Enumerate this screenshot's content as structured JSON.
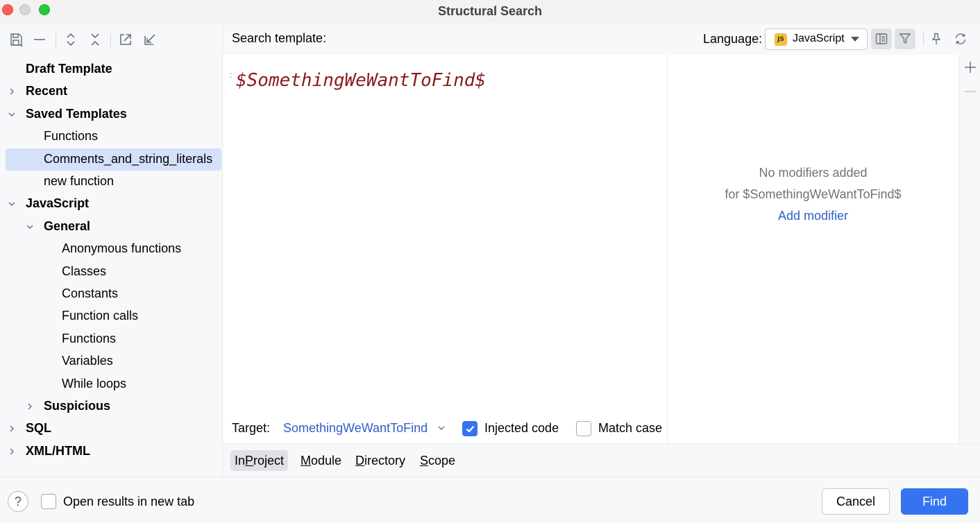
{
  "window": {
    "title": "Structural Search"
  },
  "tree": {
    "items": [
      {
        "label": "Draft Template",
        "bold": true,
        "level": 0,
        "expander": "none"
      },
      {
        "label": "Recent",
        "bold": true,
        "level": 0,
        "expander": "collapsed"
      },
      {
        "label": "Saved Templates",
        "bold": true,
        "level": 0,
        "expander": "expanded"
      },
      {
        "label": "Functions",
        "bold": false,
        "level": 1,
        "expander": "none"
      },
      {
        "label": "Comments_and_string_literals",
        "bold": false,
        "level": 1,
        "expander": "none",
        "selected": true
      },
      {
        "label": "new function",
        "bold": false,
        "level": 1,
        "expander": "none"
      },
      {
        "label": "JavaScript",
        "bold": true,
        "level": 0,
        "expander": "expanded"
      },
      {
        "label": "General",
        "bold": true,
        "level": 1,
        "expander": "expanded"
      },
      {
        "label": "Anonymous functions",
        "bold": false,
        "level": 2,
        "expander": "none"
      },
      {
        "label": "Classes",
        "bold": false,
        "level": 2,
        "expander": "none"
      },
      {
        "label": "Constants",
        "bold": false,
        "level": 2,
        "expander": "none"
      },
      {
        "label": "Function calls",
        "bold": false,
        "level": 2,
        "expander": "none"
      },
      {
        "label": "Functions",
        "bold": false,
        "level": 2,
        "expander": "none"
      },
      {
        "label": "Variables",
        "bold": false,
        "level": 2,
        "expander": "none"
      },
      {
        "label": "While loops",
        "bold": false,
        "level": 2,
        "expander": "none"
      },
      {
        "label": "Suspicious",
        "bold": true,
        "level": 1,
        "expander": "collapsed"
      },
      {
        "label": "SQL",
        "bold": true,
        "level": 0,
        "expander": "collapsed"
      },
      {
        "label": "XML/HTML",
        "bold": true,
        "level": 0,
        "expander": "collapsed"
      }
    ]
  },
  "search": {
    "label": "Search template:",
    "template_text": "$SomethingWeWantToFind$",
    "language_label": "Language:",
    "language_value": "JavaScript",
    "language_badge": "JS"
  },
  "modifiers": {
    "empty_line1": "No modifiers added",
    "empty_line2": "for $SomethingWeWantToFind$",
    "add_link": "Add modifier"
  },
  "target": {
    "label": "Target:",
    "value": "SomethingWeWantToFind",
    "injected_code_label": "Injected code",
    "injected_code_checked": true,
    "match_case_label": "Match case",
    "match_case_checked": false
  },
  "scope": {
    "tabs": [
      {
        "prefix": "In ",
        "mnemonic": "P",
        "rest": "roject",
        "active": true
      },
      {
        "prefix": "",
        "mnemonic": "M",
        "rest": "odule",
        "active": false
      },
      {
        "prefix": "",
        "mnemonic": "D",
        "rest": "irectory",
        "active": false
      },
      {
        "prefix": "",
        "mnemonic": "S",
        "rest": "cope",
        "active": false
      }
    ]
  },
  "footer": {
    "help_glyph": "?",
    "open_new_tab_label": "Open results in new tab",
    "cancel_label": "Cancel",
    "find_label": "Find"
  },
  "colors": {
    "accent": "#3574f0",
    "link": "#2f5ec4",
    "selection": "#d5e1f9",
    "template_text": "#8b1a1a"
  }
}
